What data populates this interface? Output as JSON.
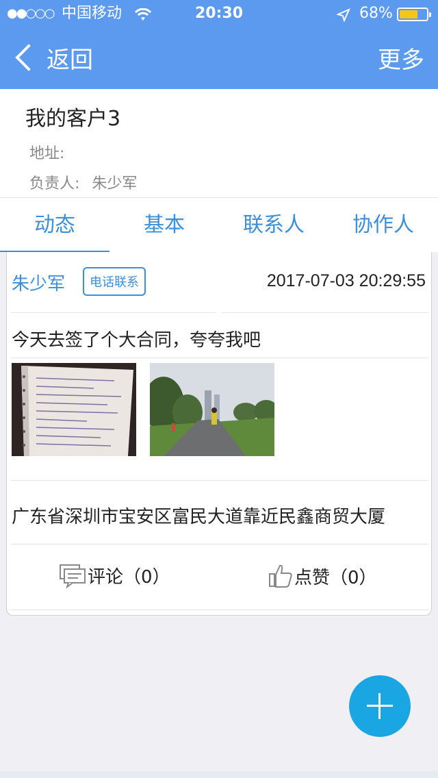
{
  "status_bar": {
    "signal": "●●○○○",
    "carrier": "中国移动",
    "time": "20:30",
    "battery_percent": "68%",
    "battery_level": 0.68,
    "battery_color": "#f8c415"
  },
  "nav": {
    "back_label": "返回",
    "more_label": "更多",
    "background": "#5b9aee"
  },
  "customer": {
    "name": "我的客户3",
    "address_label": "地址:",
    "address_value": "",
    "owner_label": "负责人:",
    "owner_value": "朱少军"
  },
  "tabs": [
    {
      "label": "动态",
      "active": true
    },
    {
      "label": "基本",
      "active": false
    },
    {
      "label": "联系人",
      "active": false
    },
    {
      "label": "协作人",
      "active": false
    }
  ],
  "post": {
    "author": "朱少军",
    "tag": "电话联系",
    "timestamp": "2017-07-03 20:29:55",
    "content": "今天去签了个大合同，夸夸我吧",
    "location": "广东省深圳市宝安区富民大道靠近民鑫商贸大厦",
    "comment_label": "评论（0）",
    "like_label": "点赞（0）"
  },
  "icons": {
    "back": "chevron-left-icon",
    "wifi": "wifi-icon",
    "location": "location-arrow-icon",
    "comment": "comment-icon",
    "like": "thumbs-up-icon",
    "add": "plus-icon"
  },
  "accent_color": "#3b8fd9",
  "fab_color": "#1aa5e3"
}
